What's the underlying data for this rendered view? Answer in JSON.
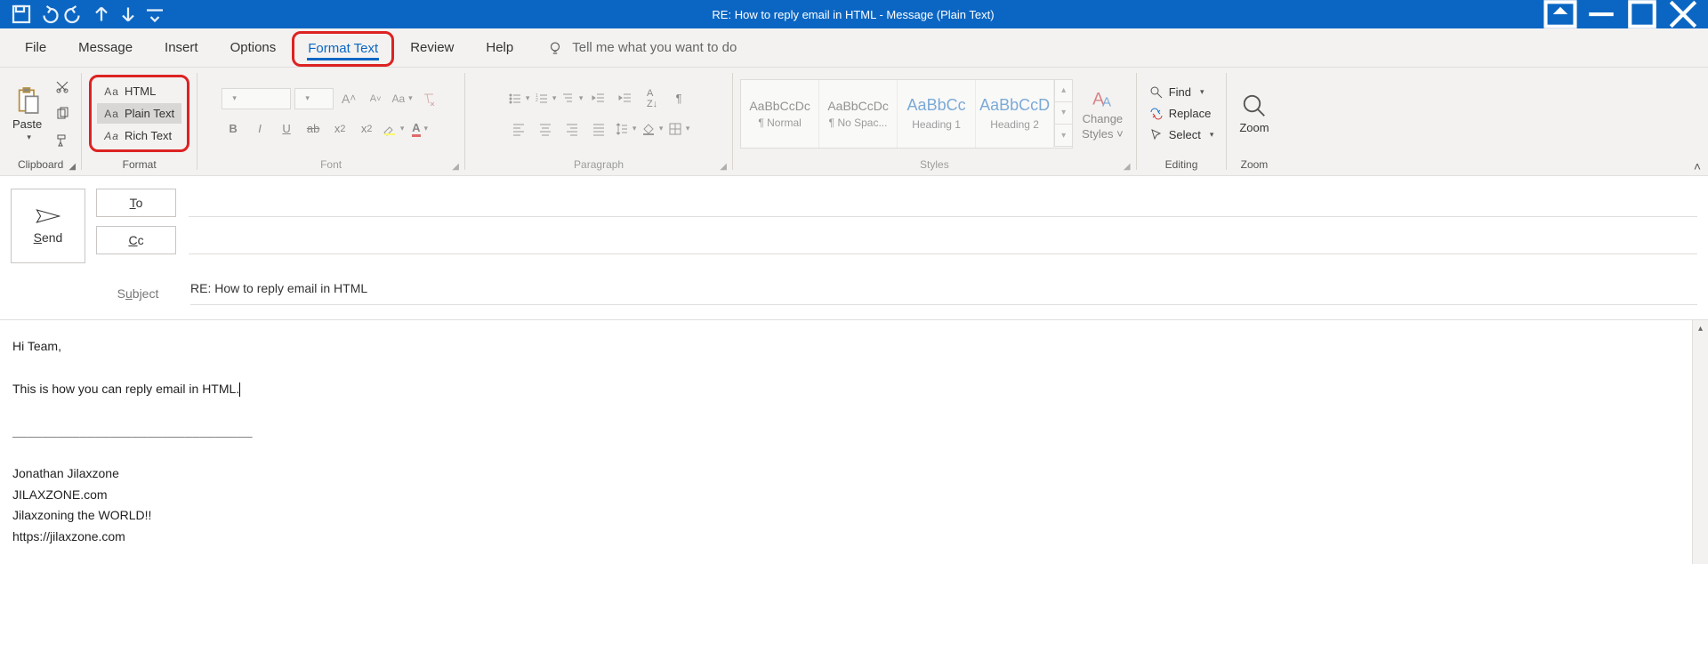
{
  "titlebar": {
    "title": "RE: How to reply email in HTML  -  Message (Plain Text)"
  },
  "tabs": {
    "file": "File",
    "message": "Message",
    "insert": "Insert",
    "options": "Options",
    "format_text": "Format Text",
    "review": "Review",
    "help": "Help",
    "tell_me": "Tell me what you want to do"
  },
  "ribbon": {
    "clipboard": {
      "label": "Clipboard",
      "paste": "Paste"
    },
    "format": {
      "label": "Format",
      "html": "HTML",
      "plain": "Plain Text",
      "rich": "Rich Text"
    },
    "font": {
      "label": "Font"
    },
    "paragraph": {
      "label": "Paragraph"
    },
    "styles": {
      "label": "Styles",
      "items": [
        {
          "sample": "AaBbCcDc",
          "name": "¶ Normal"
        },
        {
          "sample": "AaBbCcDc",
          "name": "¶ No Spac..."
        },
        {
          "sample": "AaBbCc",
          "name": "Heading 1"
        },
        {
          "sample": "AaBbCcD",
          "name": "Heading 2"
        }
      ],
      "change": "Change",
      "change2": "Styles ˅"
    },
    "editing": {
      "label": "Editing",
      "find": "Find",
      "replace": "Replace",
      "select": "Select"
    },
    "zoom": {
      "label": "Zoom",
      "btn": "Zoom"
    }
  },
  "compose": {
    "send": "Send",
    "to": "To",
    "cc": "Cc",
    "subject_label": "Subject",
    "subject": "RE: How to reply email in HTML"
  },
  "body": {
    "l1": "Hi Team,",
    "l2": "This is how you can reply email in HTML.",
    "l3": "________________________________",
    "l4": "Jonathan Jilaxzone",
    "l5": "JILAXZONE.com",
    "l6": "Jilaxzoning the WORLD!!",
    "l7": "https://jilaxzone.com"
  }
}
